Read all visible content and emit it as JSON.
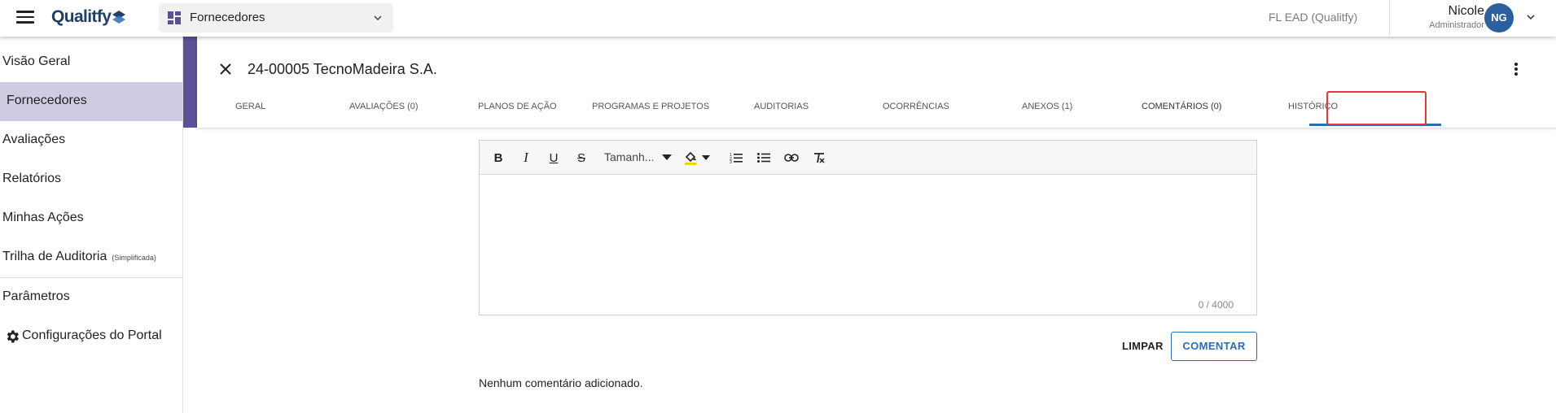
{
  "app": {
    "brand": "Qualitfy"
  },
  "module_selector": {
    "label": "Fornecedores"
  },
  "org": {
    "name": "FL EAD (Qualitfy)"
  },
  "user": {
    "name": "Nicole",
    "role": "Administrador",
    "initials": "NG"
  },
  "colors": {
    "accent": "#5b4f96",
    "sidebar_active": "#d0cbe2",
    "primary": "#2a6db0",
    "highlight": "#e53935",
    "avatar": "#2c5f9e"
  },
  "sidebar": {
    "items": [
      {
        "label": "Visão Geral"
      },
      {
        "label": "Fornecedores"
      },
      {
        "label": "Avaliações"
      },
      {
        "label": "Relatórios"
      },
      {
        "label": "Minhas Ações"
      },
      {
        "label": "Trilha de Auditoria",
        "note": "(Simplificada)"
      },
      {
        "label": "Parâmetros"
      },
      {
        "label": "Configurações do Portal",
        "icon": "gear-icon"
      }
    ]
  },
  "record": {
    "title": "24-00005 TecnoMadeira S.A."
  },
  "tabs": [
    {
      "label": "GERAL"
    },
    {
      "label": "AVALIAÇÕES (0)"
    },
    {
      "label": "PLANOS DE AÇÃO"
    },
    {
      "label": "PROGRAMAS E PROJETOS"
    },
    {
      "label": "AUDITORIAS"
    },
    {
      "label": "OCORRÊNCIAS"
    },
    {
      "label": "ANEXOS (1)"
    },
    {
      "label": "COMENTÁRIOS (0)"
    },
    {
      "label": "HISTÓRICO"
    }
  ],
  "editor": {
    "font_size_label": "Tamanh...",
    "char_count": "0 / 4000",
    "toolbar_icons": [
      "bold-icon",
      "italic-icon",
      "underline-icon",
      "strikethrough-icon",
      "text-color-icon",
      "ordered-list-icon",
      "bullet-list-icon",
      "link-icon",
      "clear-format-icon"
    ]
  },
  "actions": {
    "clear_label": "LIMPAR",
    "comment_label": "COMENTAR"
  },
  "comments": {
    "empty_message": "Nenhum comentário adicionado."
  }
}
